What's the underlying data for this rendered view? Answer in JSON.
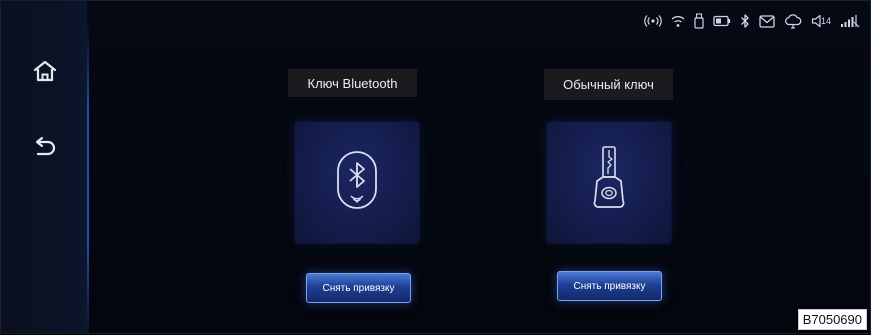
{
  "sidebar": {
    "home_icon": "home-icon",
    "back_icon": "back-arrow-icon"
  },
  "status_bar": {
    "icons": [
      "hotspot-icon",
      "wifi-icon",
      "usb-icon",
      "battery-icon",
      "bluetooth-icon",
      "message-icon",
      "cloud-icon",
      "volume-icon",
      "signal-icon"
    ],
    "volume_level": "14"
  },
  "keys": {
    "bluetooth": {
      "title": "Ключ Bluetooth",
      "icon": "bluetooth-key-icon",
      "unbind_label": "Снять привязку"
    },
    "regular": {
      "title": "Обычный ключ",
      "icon": "car-key-icon",
      "unbind_label": "Снять привязку"
    }
  },
  "watermark": "B7050690"
}
